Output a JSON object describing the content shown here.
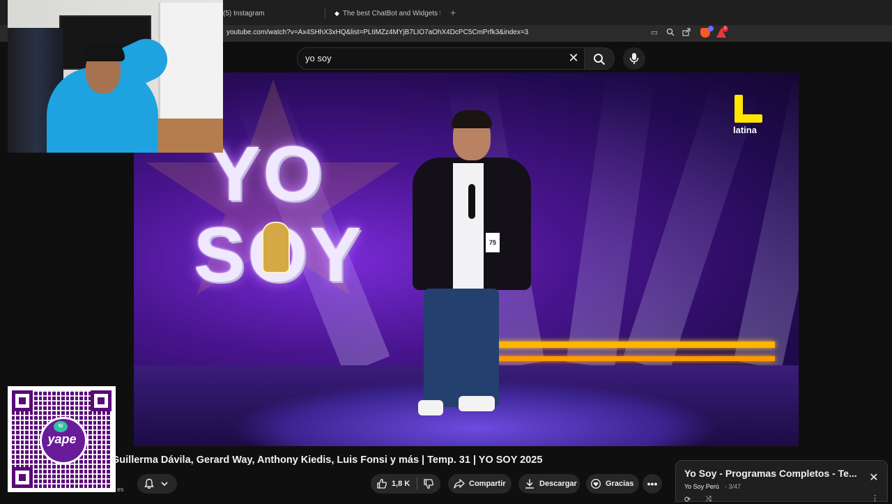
{
  "browser": {
    "tabs": [
      {
        "label": "(5) Instagram"
      },
      {
        "label": "The best ChatBot and Widgets for Ki"
      }
    ],
    "new_tab_symbol": "+",
    "url": "youtube.com/watch?v=Ax4SHhX3xHQ&list=PLtiMZz4MYjB7LIO7aOhX4DcPC5CmPrfk3&index=3",
    "rewards_count": "3"
  },
  "search": {
    "query": "yo soy",
    "clear_symbol": "✕"
  },
  "video": {
    "logo_line1": "YO",
    "logo_line2": "SOY",
    "channel_bug": "latina",
    "contestant_number": "75"
  },
  "qr": {
    "currency_badge": "S/",
    "brand": "yape"
  },
  "details": {
    "title": "Guillerma Dávila, Gerard Way, Anthony Kiedis, Luis Fonsi y más | Temp. 31 | YO SOY 2025",
    "subscribers_fragment": "es",
    "like_count": "1,8 K",
    "share_label": "Compartir",
    "download_label": "Descargar",
    "thanks_label": "Gracias",
    "more_symbol": "•••"
  },
  "playlist": {
    "title": "Yo Soy - Programas Completos - Te...",
    "channel": "Yo Soy Perú",
    "index": "- 3/47",
    "close_symbol": "✕"
  },
  "colors": {
    "background": "#0f0f0f",
    "pill": "#272727",
    "latina_yellow": "#ffe500",
    "stage_purple": "#4a1590"
  }
}
